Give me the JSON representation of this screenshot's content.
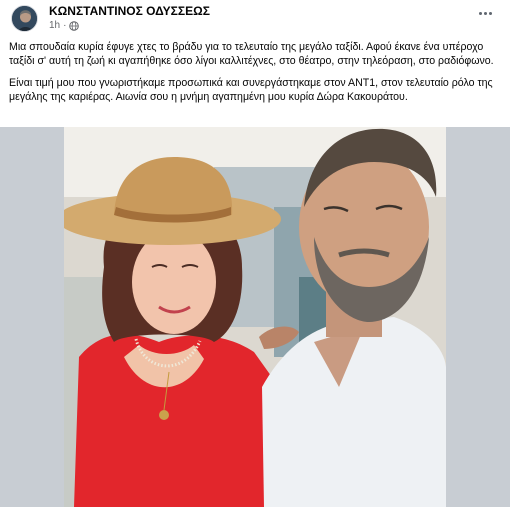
{
  "post": {
    "author": "ΚΩΝΣΤΑΝΤΙΝΟΣ ΟΔΥΣΣΕΩΣ",
    "time": "1h",
    "audience_icon": "globe-icon",
    "more_icon": "more-options-icon",
    "paragraphs": [
      "Μια σπουδαία κυρία έφυγε χτες το βράδυ για το τελευταίο της μεγάλο ταξίδι. Αφού έκανε ένα υπέροχο ταξίδι σ' αυτή τη ζωή κι αγαπήθηκε όσο λίγοι καλλιτέχνες, στο θέατρο, στην τηλεόραση, στο ραδιόφωνο.",
      "Είναι τιμή μου που γνωριστήκαμε προσωπικά και συνεργάστηκαμε στον ΑΝΤ1, στον τελευταίο ρόλο της μεγάλης της καριέρας. Αιωνία σου η μνήμη αγαπημένη μου κυρία Δώρα Κακουράτου."
    ]
  },
  "colors": {
    "author_text": "#050505",
    "meta_text": "#65676b",
    "photo_sidebar": "#c8cdd3"
  }
}
